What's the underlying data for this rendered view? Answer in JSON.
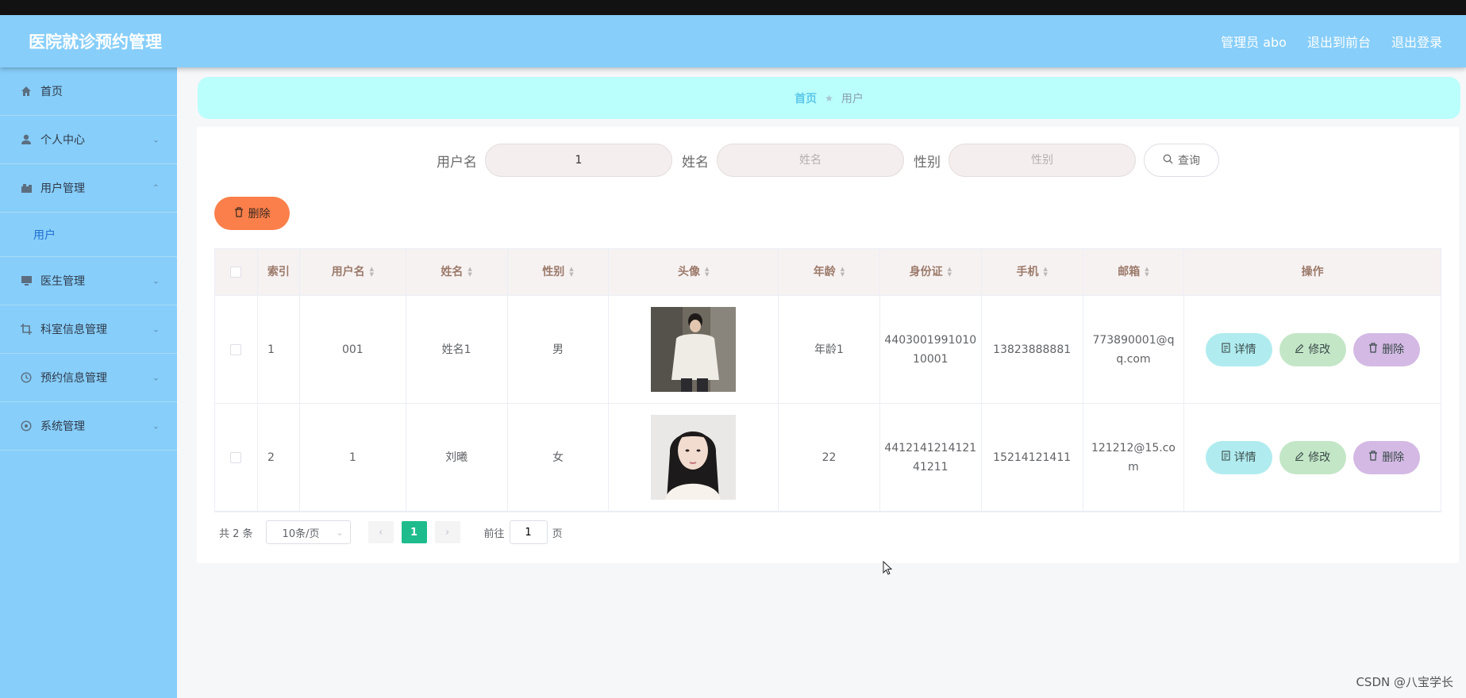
{
  "header": {
    "title": "医院就诊预约管理",
    "links": [
      "管理员 abo",
      "退出到前台",
      "退出登录"
    ]
  },
  "sidebar": {
    "items": [
      {
        "label": "首页",
        "icon": "home-icon"
      },
      {
        "label": "个人中心",
        "icon": "user-icon"
      },
      {
        "label": "用户管理",
        "icon": "users-icon"
      },
      {
        "label": "用户",
        "icon": ""
      },
      {
        "label": "医生管理",
        "icon": "monitor-icon"
      },
      {
        "label": "科室信息管理",
        "icon": "crop-icon"
      },
      {
        "label": "预约信息管理",
        "icon": "clock-icon"
      },
      {
        "label": "系统管理",
        "icon": "settings-icon"
      }
    ]
  },
  "breadcrumb": {
    "home": "首页",
    "current": "用户"
  },
  "search": {
    "username_label": "用户名",
    "username_value": "1",
    "name_label": "姓名",
    "name_placeholder": "姓名",
    "gender_label": "性别",
    "gender_placeholder": "性别",
    "button": "查询"
  },
  "actions": {
    "delete": "删除"
  },
  "table": {
    "columns": [
      "索引",
      "用户名",
      "姓名",
      "性别",
      "头像",
      "年龄",
      "身份证",
      "手机",
      "邮箱",
      "操作"
    ],
    "rows": [
      {
        "index": "1",
        "username": "001",
        "name": "姓名1",
        "gender": "男",
        "age": "年龄1",
        "id_card": "440300199101010001",
        "phone": "13823888881",
        "email": "773890001@qq.com"
      },
      {
        "index": "2",
        "username": "1",
        "name": "刘曦",
        "gender": "女",
        "age": "22",
        "id_card": "441214121412141211",
        "phone": "15214121411",
        "email": "121212@15.com"
      }
    ],
    "op_labels": {
      "detail": "详情",
      "edit": "修改",
      "delete": "删除"
    }
  },
  "pagination": {
    "total": "共 2 条",
    "page_size": "10条/页",
    "current_page": "1",
    "goto_label": "前往",
    "goto_value": "1",
    "page_suffix": "页"
  },
  "watermark": "CSDN @八宝学长",
  "colors": {
    "header": "#87cefa",
    "sidebar": "#87cefa",
    "breadcrumb": "#bbfffc",
    "delete": "#fb7f4a",
    "detail": "#b0ecef",
    "edit": "#c3e6c7",
    "row_delete": "#d4b9e4",
    "page_active": "#1ebc8c"
  }
}
